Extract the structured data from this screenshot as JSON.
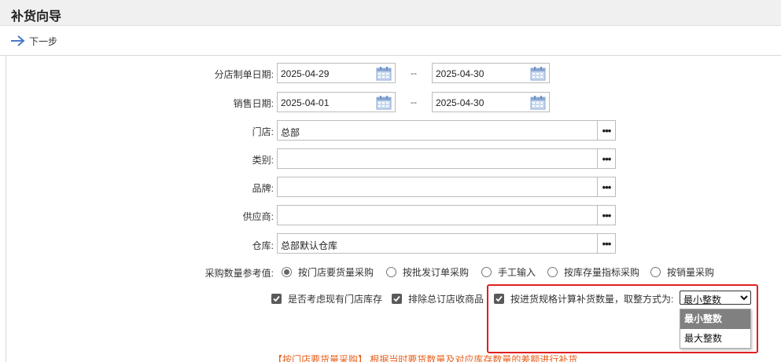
{
  "window": {
    "title": "补货向导"
  },
  "toolbar": {
    "next_label": "下一步"
  },
  "form": {
    "order_date": {
      "label": "分店制单日期:",
      "from": "2025-04-29",
      "sep": "--",
      "to": "2025-04-30"
    },
    "sale_date": {
      "label": "销售日期:",
      "from": "2025-04-01",
      "sep": "--",
      "to": "2025-04-30"
    },
    "store": {
      "label": "门店:",
      "value": "总部",
      "more": "•••"
    },
    "category": {
      "label": "类别:",
      "value": "",
      "more": "•••"
    },
    "brand": {
      "label": "品牌:",
      "value": "",
      "more": "•••"
    },
    "supplier": {
      "label": "供应商:",
      "value": "",
      "more": "•••"
    },
    "warehouse": {
      "label": "仓库:",
      "value": "总部默认仓库",
      "more": "•••"
    },
    "ref_label": "采购数量参考值:",
    "ref_options": [
      "按门店要货量采购",
      "按批发订单采购",
      "手工输入",
      "按库存量指标采购",
      "按销量采购"
    ],
    "ref_selected": 0,
    "checks": [
      {
        "label": "是否考虑现有门店库存",
        "checked": true
      },
      {
        "label": "排除总订店收商品",
        "checked": true
      },
      {
        "label": "按进货规格计算补货数量，取整方式为:",
        "checked": true
      }
    ],
    "rounding": {
      "value": "最小整数",
      "options": [
        "最小整数",
        "最大整数"
      ],
      "highlighted": 0
    }
  },
  "hint": "【按门店要货量采购】 根据当时要货数量及对应库存数量的差额进行补货"
}
